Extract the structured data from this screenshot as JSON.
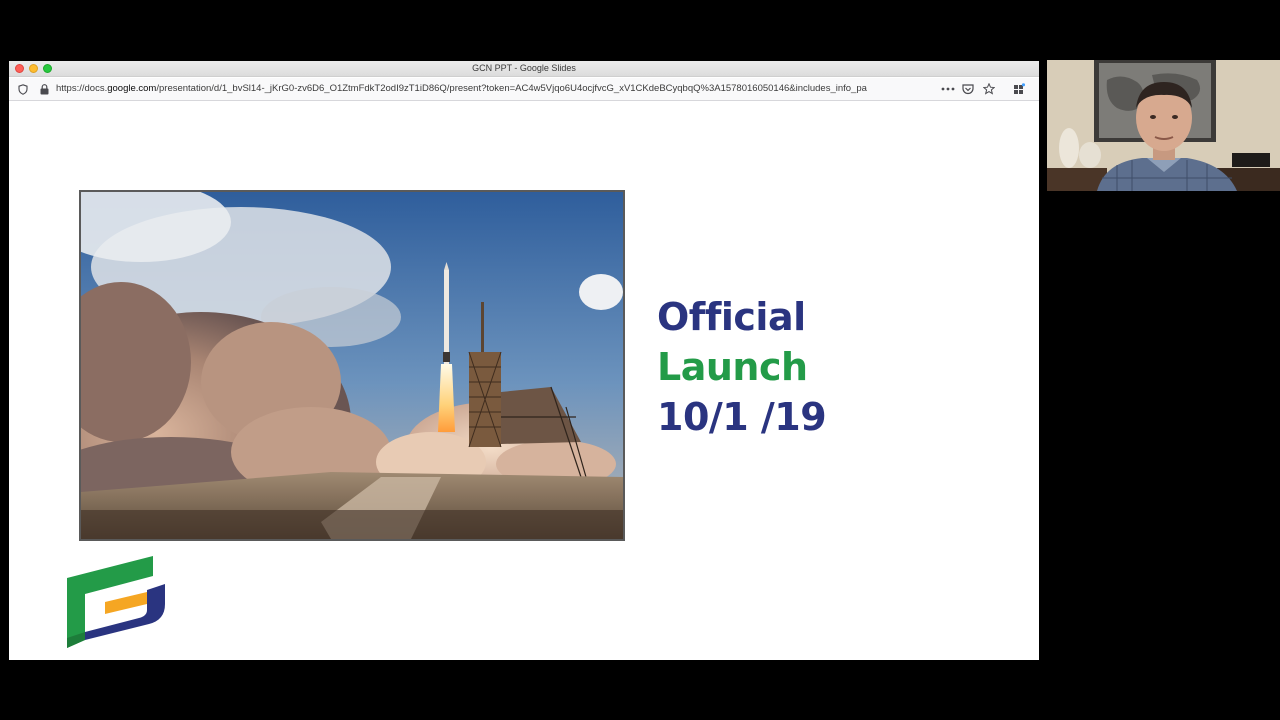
{
  "window": {
    "title": "GCN PPT - Google Slides"
  },
  "urlbar": {
    "url_prefix": "https://docs.",
    "url_host": "google.com",
    "url_path": "/presentation/d/1_bvSl14-_jKrG0-zv6D6_O1ZtmFdkT2odI9zT1iD86Q/present?token=AC4w5Vjqo6U4ocjfvcG_xV1CKdeBCyqbqQ%3A1578016050146&includes_info_pa",
    "icons": [
      "shield-icon",
      "lock-icon",
      "more-icon",
      "pocket-icon",
      "star-icon",
      "extension-icon"
    ]
  },
  "slide": {
    "headline_line1": "Official",
    "headline_line2": "Launch",
    "headline_line3": "10/1 /19",
    "colors": {
      "navy": "#2a3480",
      "green": "#239b48",
      "orange": "#f5a623"
    }
  }
}
